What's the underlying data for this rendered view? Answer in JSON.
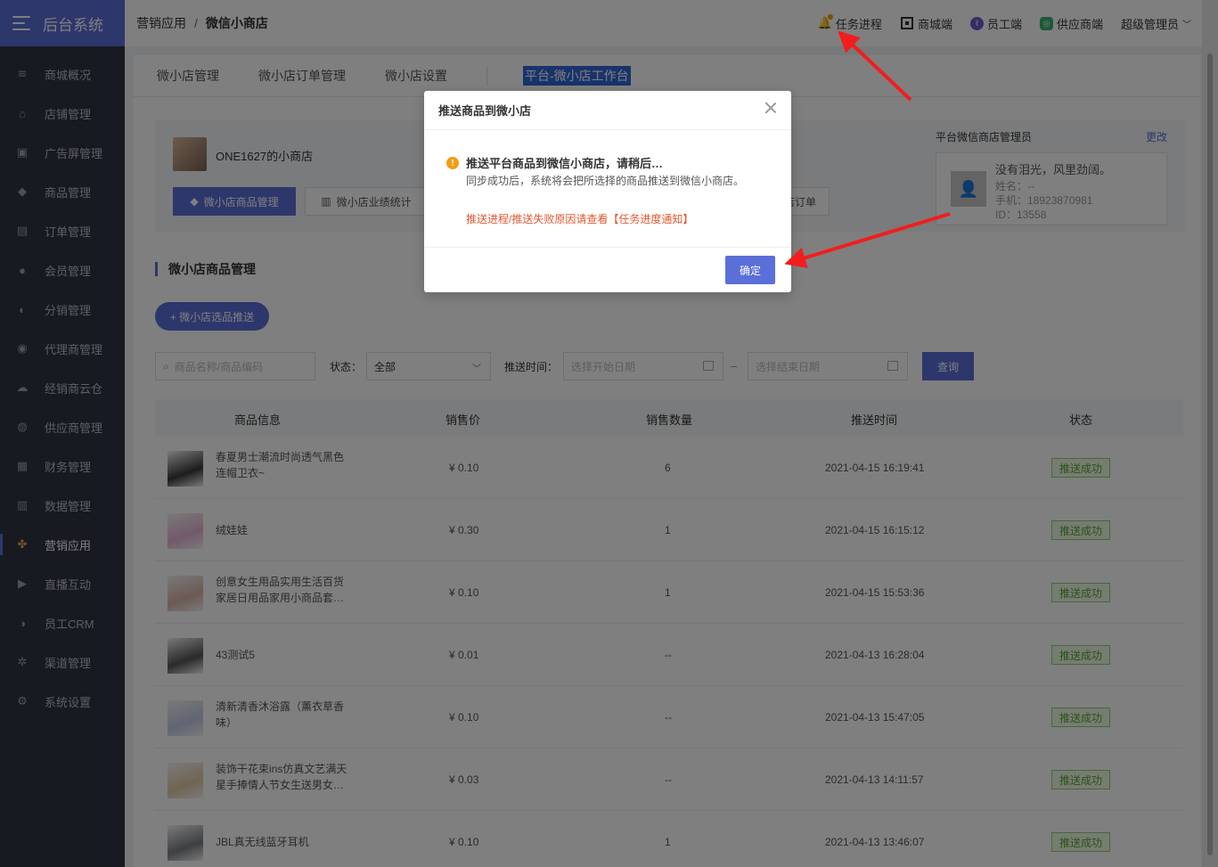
{
  "app": {
    "title": "后台系统"
  },
  "sidebar": {
    "items": [
      {
        "label": "商城概况",
        "icon": "layers-icon",
        "glyph": "≋"
      },
      {
        "label": "店铺管理",
        "icon": "basket-icon",
        "glyph": "⌂"
      },
      {
        "label": "广告屏管理",
        "icon": "screen-icon",
        "glyph": "▣"
      },
      {
        "label": "商品管理",
        "icon": "cube-icon",
        "glyph": "◆"
      },
      {
        "label": "订单管理",
        "icon": "list-icon",
        "glyph": "▤"
      },
      {
        "label": "会员管理",
        "icon": "user-icon",
        "glyph": "●"
      },
      {
        "label": "分销管理",
        "icon": "users-icon",
        "glyph": "◐"
      },
      {
        "label": "代理商管理",
        "icon": "group-icon",
        "glyph": "◉"
      },
      {
        "label": "经销商云仓",
        "icon": "cloud-icon",
        "glyph": "☁"
      },
      {
        "label": "供应商管理",
        "icon": "supplier-icon",
        "glyph": "◍"
      },
      {
        "label": "财务管理",
        "icon": "wallet-icon",
        "glyph": "▦"
      },
      {
        "label": "数据管理",
        "icon": "bar-chart-icon",
        "glyph": "▥"
      },
      {
        "label": "营销应用",
        "icon": "apps-icon",
        "glyph": "✤",
        "active": true
      },
      {
        "label": "直播互动",
        "icon": "video-icon",
        "glyph": "▶"
      },
      {
        "label": "员工CRM",
        "icon": "staff-icon",
        "glyph": "◑"
      },
      {
        "label": "渠道管理",
        "icon": "channel-icon",
        "glyph": "✲"
      },
      {
        "label": "系统设置",
        "icon": "gear-icon",
        "glyph": "⚙"
      }
    ]
  },
  "header": {
    "breadcrumb": [
      "营销应用",
      "微信小商店"
    ],
    "separator": "/",
    "actions": {
      "task": "任务进程",
      "mall": "商城端",
      "staff": "员工端",
      "supplier": "供应商端",
      "admin": "超级管理员"
    }
  },
  "tabs": [
    "微小店管理",
    "微小店订单管理",
    "微小店设置"
  ],
  "tab_highlight": "平台-微小店工作台",
  "shop": {
    "name": "ONE1627的小商店",
    "btn_goods": "微小店商品管理",
    "btn_stats": "微小店业绩统计",
    "btn_orders_tail": "店订单"
  },
  "admin": {
    "label": "平台微信商店管理员",
    "edit": "更改",
    "nickname": "没有泪光，风里劲阔。",
    "name_line": "姓名：--",
    "phone_line": "手机：18923870981",
    "id_line": "ID：13558"
  },
  "section": {
    "title": "微小店商品管理",
    "push_button": "+ 微小店选品推送"
  },
  "filters": {
    "search_placeholder": "商品名称/商品编码",
    "status_label": "状态：",
    "status_value": "全部",
    "time_label": "推送时间：",
    "start_placeholder": "选择开始日期",
    "range_sep": "–",
    "end_placeholder": "选择结束日期",
    "query": "查询"
  },
  "table": {
    "headers": [
      "商品信息",
      "销售价",
      "销售数量",
      "推送时间",
      "状态"
    ],
    "rows": [
      {
        "name": "春夏男士潮流时尚透气黑色连帽卫衣~",
        "price": "¥ 0.10",
        "qty": "6",
        "time": "2021-04-15 16:19:41",
        "status": "推送成功",
        "color": "#3a3a3a"
      },
      {
        "name": "绒娃娃",
        "price": "¥ 0.30",
        "qty": "1",
        "time": "2021-04-15 16:15:12",
        "status": "推送成功",
        "color": "#e6b3d6"
      },
      {
        "name": "创意女生用品实用生活百货家居日用品家用小商品套…",
        "price": "¥ 0.10",
        "qty": "1",
        "time": "2021-04-15 15:53:36",
        "status": "推送成功",
        "color": "#d8b4a8"
      },
      {
        "name": "43测试5",
        "price": "¥ 0.01",
        "qty": "--",
        "time": "2021-04-13 16:28:04",
        "status": "推送成功",
        "color": "#555555"
      },
      {
        "name": "清新清香沐浴露（薰衣草香味）",
        "price": "¥ 0.10",
        "qty": "--",
        "time": "2021-04-13 15:47:05",
        "status": "推送成功",
        "color": "#c3c9e6"
      },
      {
        "name": "装饰干花束ins仿真文艺满天星手捧情人节女生送男女…",
        "price": "¥ 0.03",
        "qty": "--",
        "time": "2021-04-13 14:11:57",
        "status": "推送成功",
        "color": "#e2c9a6"
      },
      {
        "name": "JBL真无线蓝牙耳机",
        "price": "¥ 0.10",
        "qty": "1",
        "time": "2021-04-13 13:46:07",
        "status": "推送成功",
        "color": "#7a7f86"
      }
    ]
  },
  "modal": {
    "title": "推送商品到微小店",
    "heading": "推送平台商品到微信小商店，请稍后…",
    "desc": "同步成功后，系统将会把所选择的商品推送到微信小商店。",
    "link": "推送进程/推送失败原因请查看【任务进度通知】",
    "ok": "确定",
    "warn_glyph": "!"
  },
  "colors": {
    "accent": "#5b6fd9",
    "sidebar": "#2f3542",
    "success": "#52a829",
    "warn": "#f39c12",
    "link": "#e4572e",
    "arrow": "#f21d1d"
  }
}
